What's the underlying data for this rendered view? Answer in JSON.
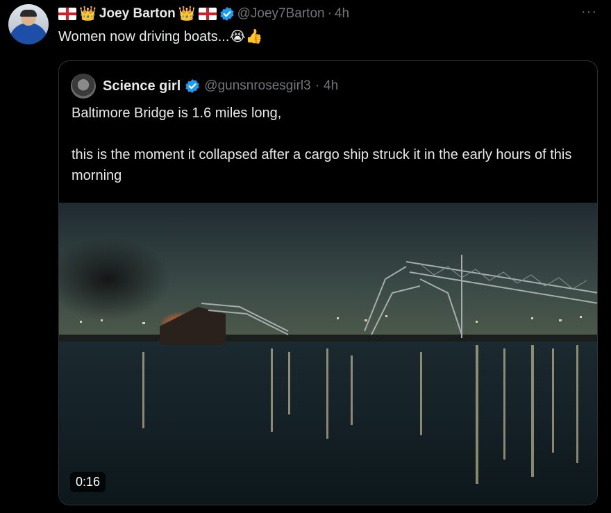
{
  "tweet": {
    "author_name": "Joey Barton",
    "author_handle": "@Joey7Barton",
    "separator": "·",
    "time": "4h",
    "text": "Women now driving boats...",
    "emojis": [
      "😭",
      "👍"
    ],
    "name_decorations": [
      "england-flag",
      "crown",
      "crown",
      "england-flag"
    ],
    "more_label": "···"
  },
  "quoted": {
    "author_name": "Science girl",
    "author_handle": "@gunsnrosesgirl3",
    "separator": "·",
    "time": "4h",
    "text_line1": "Baltimore Bridge is 1.6 miles long,",
    "text_line2": "this is the moment it collapsed after a cargo ship struck it in the early hours of this morning",
    "video_duration": "0:16"
  },
  "colors": {
    "background": "#000000",
    "text_primary": "#e7e9ea",
    "text_secondary": "#71767b",
    "border": "#2f3336",
    "verified_blue": "#1d9bf0"
  }
}
